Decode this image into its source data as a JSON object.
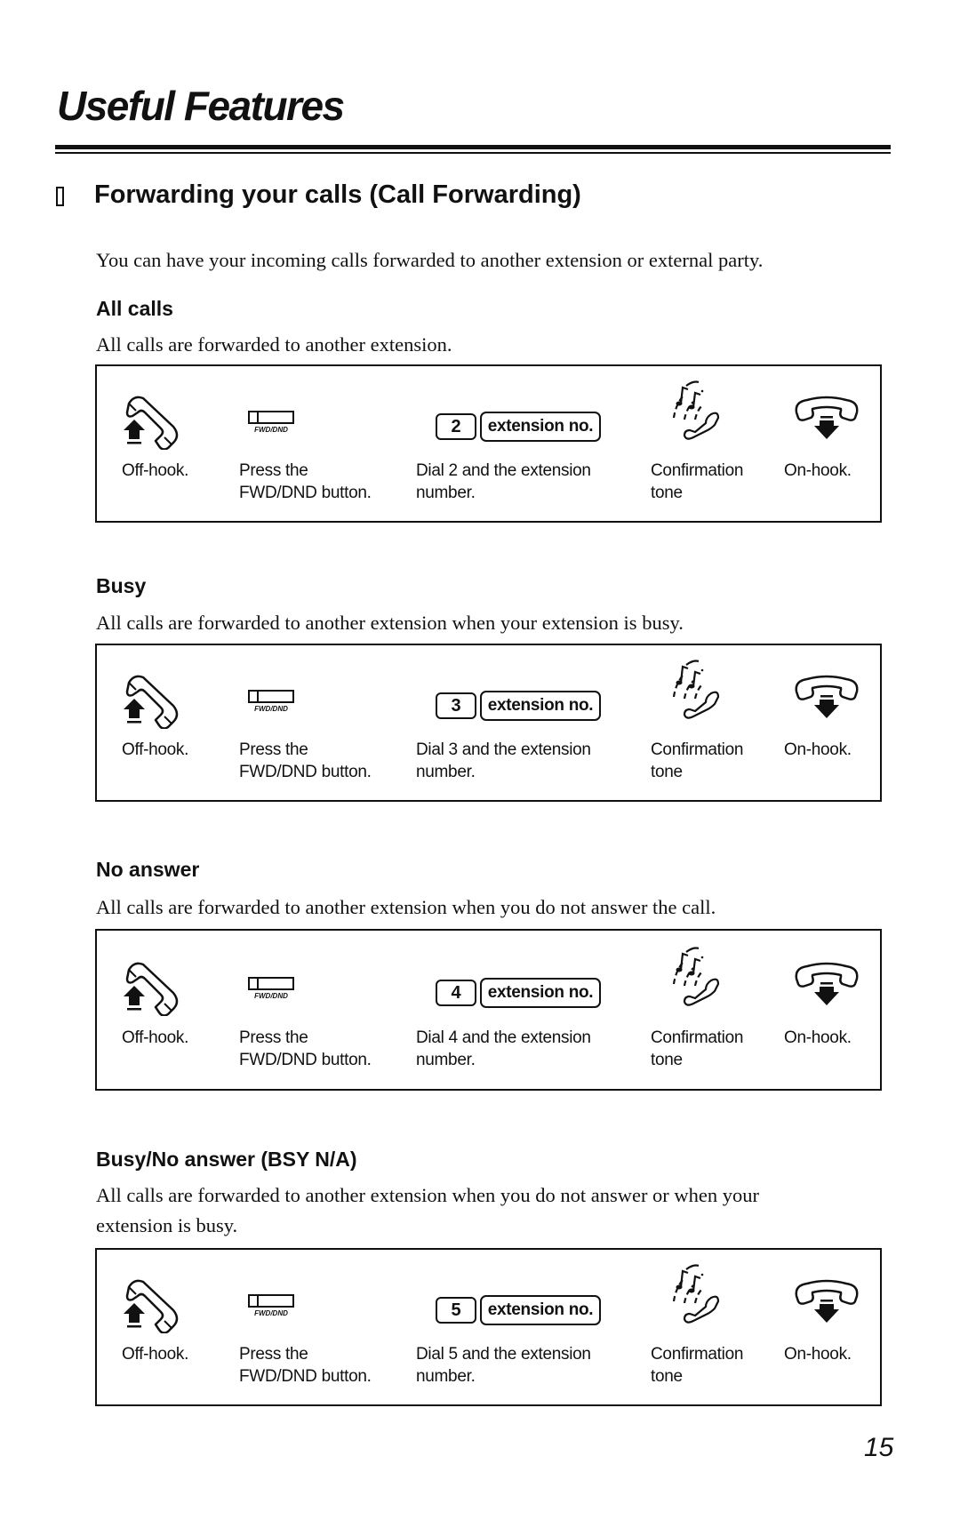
{
  "page": {
    "title": "Useful Features",
    "section_heading": "Forwarding your calls (Call Forwarding)",
    "intro": "You can have your incoming calls forwarded to another extension or external party.",
    "page_number": "15"
  },
  "modes": [
    {
      "heading": "All calls",
      "description": "All calls are forwarded to another extension.",
      "steps": {
        "off_hook": "Off-hook.",
        "press_line1": "Press the",
        "press_line2": "FWD/DND button.",
        "fwd_caption": "FWD/DND",
        "digit": "2",
        "extension_key": "extension no.",
        "dial_line1": "Dial 2 and the extension",
        "dial_line2": "number.",
        "confirm_line1": "Confirmation",
        "confirm_line2": "tone",
        "on_hook": "On-hook."
      }
    },
    {
      "heading": "Busy",
      "description": "All calls are forwarded to another extension when your extension is busy.",
      "steps": {
        "off_hook": "Off-hook.",
        "press_line1": "Press the",
        "press_line2": "FWD/DND button.",
        "fwd_caption": "FWD/DND",
        "digit": "3",
        "extension_key": "extension no.",
        "dial_line1": "Dial 3 and the extension",
        "dial_line2": "number.",
        "confirm_line1": "Confirmation",
        "confirm_line2": "tone",
        "on_hook": "On-hook."
      }
    },
    {
      "heading": "No answer",
      "description": "All calls are forwarded to another extension when you do not answer the call.",
      "steps": {
        "off_hook": "Off-hook.",
        "press_line1": "Press the",
        "press_line2": "FWD/DND button.",
        "fwd_caption": "FWD/DND",
        "digit": "4",
        "extension_key": "extension no.",
        "dial_line1": "Dial 4 and the extension",
        "dial_line2": "number.",
        "confirm_line1": "Confirmation",
        "confirm_line2": "tone",
        "on_hook": "On-hook."
      }
    },
    {
      "heading": "Busy/No answer (BSY N/A)",
      "description_line1": "All calls are forwarded to another extension when you do not answer or when your",
      "description_line2": "extension is busy.",
      "steps": {
        "off_hook": "Off-hook.",
        "press_line1": "Press the",
        "press_line2": "FWD/DND button.",
        "fwd_caption": "FWD/DND",
        "digit": "5",
        "extension_key": "extension no.",
        "dial_line1": "Dial 5 and the extension",
        "dial_line2": "number.",
        "confirm_line1": "Confirmation",
        "confirm_line2": "tone",
        "on_hook": "On-hook."
      }
    }
  ],
  "icons": {
    "off_hook": "off-hook-handset-up-arrow",
    "fwd_dnd": "fwd-dnd-button",
    "confirmation": "confirmation-tone-music-notes",
    "on_hook": "on-hook-handset-down-arrow",
    "section_bullet": "square-bullet"
  }
}
